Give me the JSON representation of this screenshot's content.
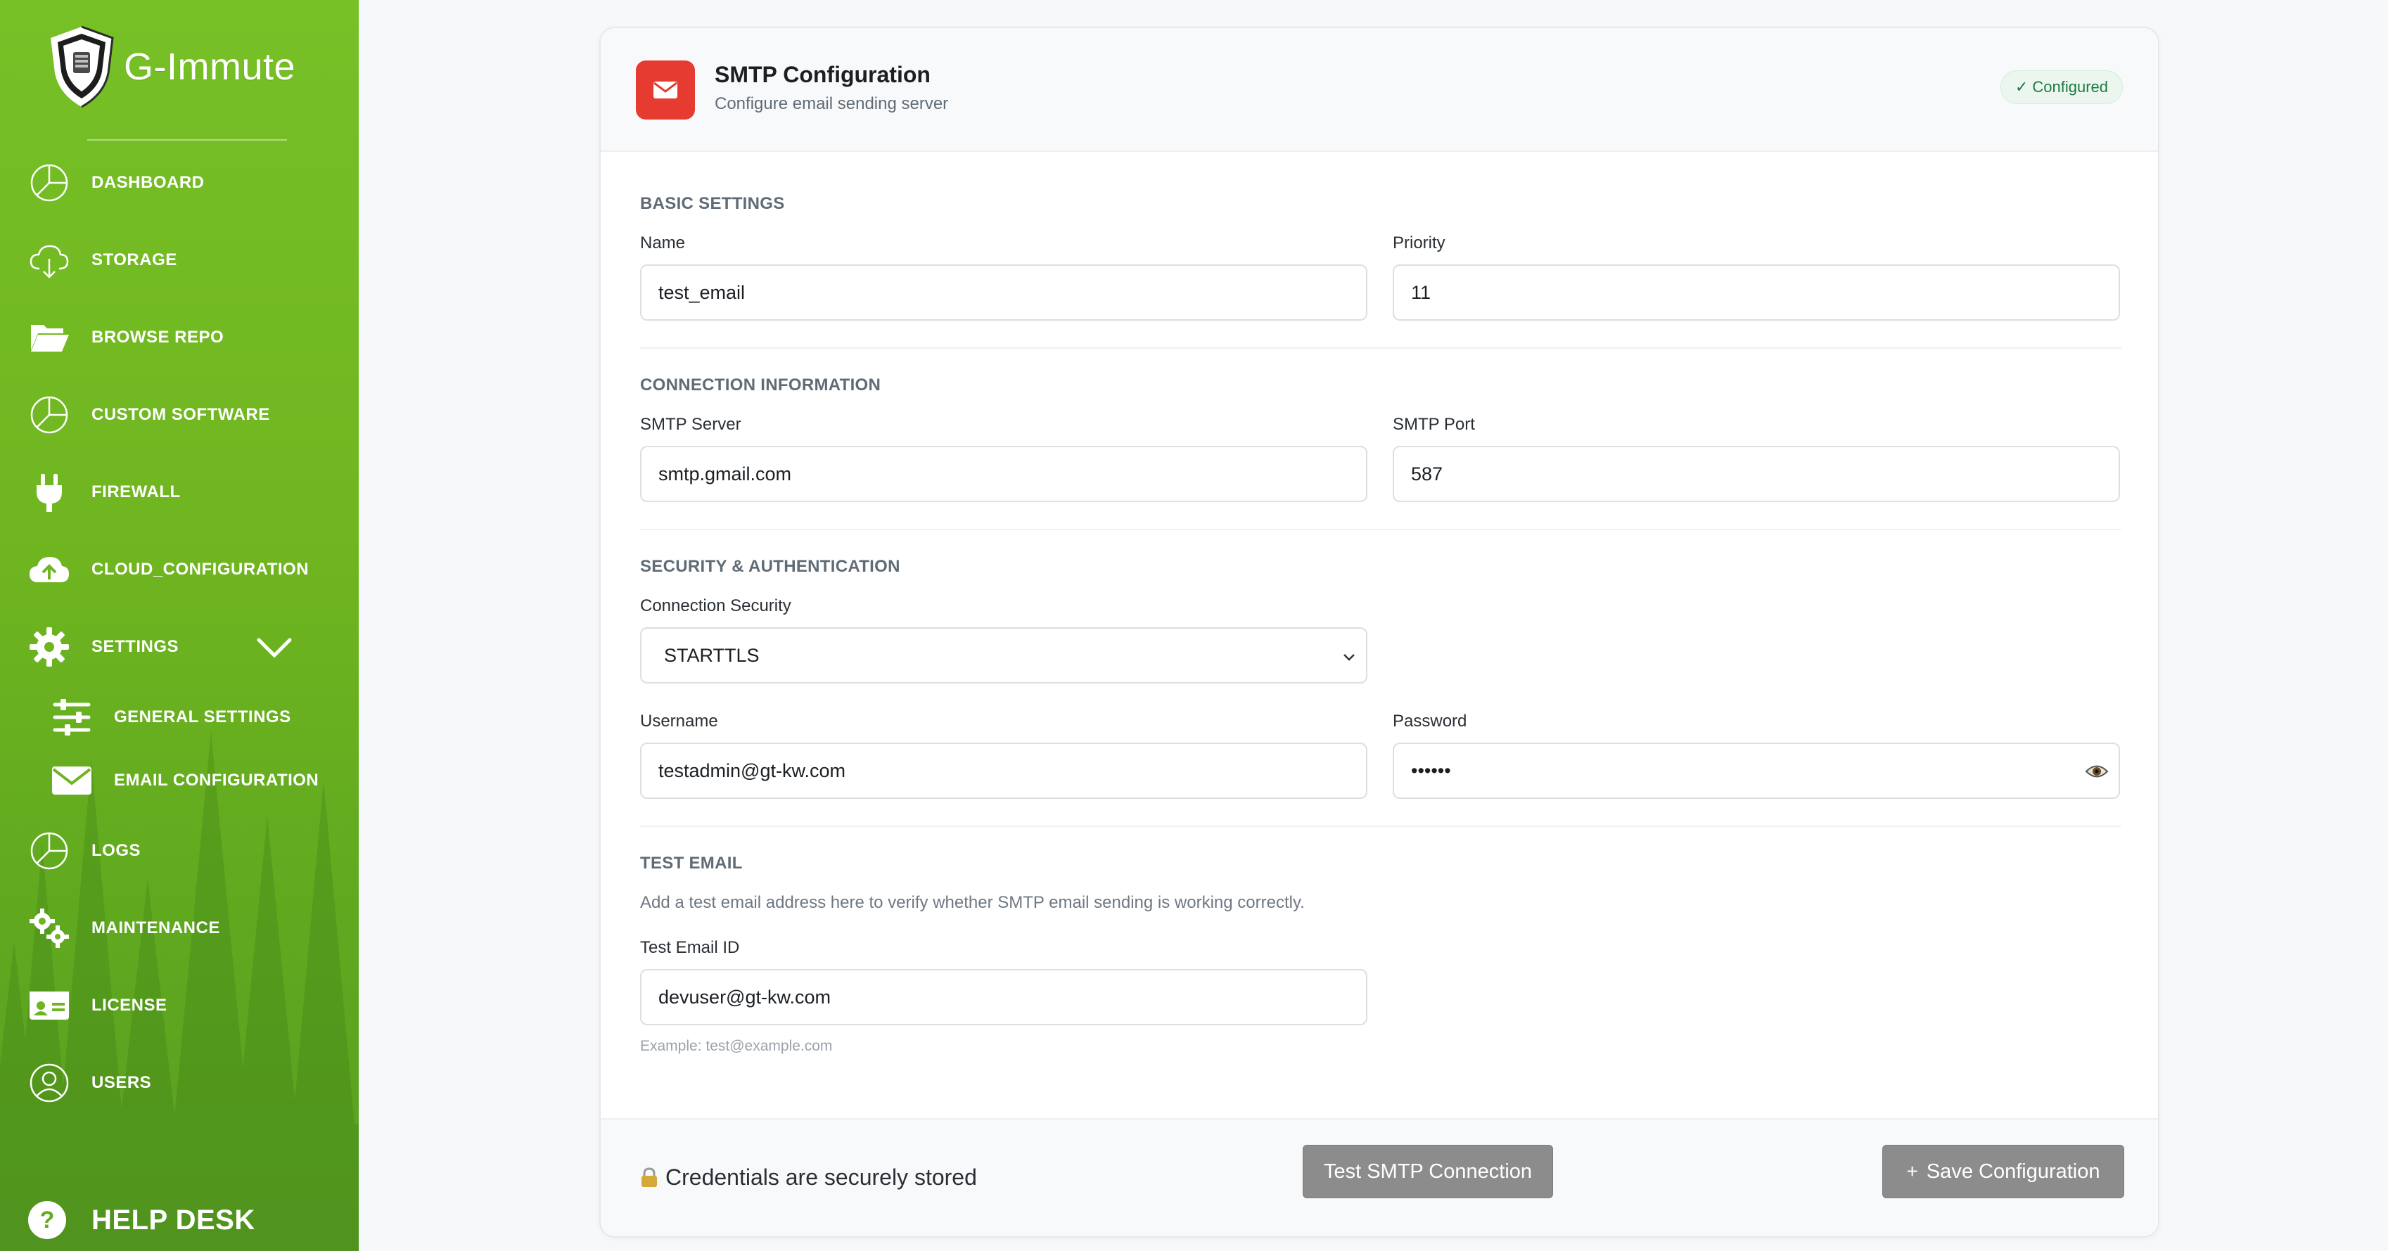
{
  "app": {
    "brand": "G-Immute"
  },
  "sidebar": {
    "items": [
      {
        "label": "DASHBOARD",
        "icon": "pie-chart-icon"
      },
      {
        "label": "STORAGE",
        "icon": "cloud-download-icon"
      },
      {
        "label": "BROWSE REPO",
        "icon": "folder-open-icon"
      },
      {
        "label": "CUSTOM SOFTWARE",
        "icon": "pie-chart-icon"
      },
      {
        "label": "FIREWALL",
        "icon": "plug-icon"
      },
      {
        "label": "CLOUD_CONFIGURATION",
        "icon": "cloud-upload-icon"
      },
      {
        "label": "SETTINGS",
        "icon": "gear-icon"
      },
      {
        "label": "LOGS",
        "icon": "pie-chart-icon"
      },
      {
        "label": "MAINTENANCE",
        "icon": "gears-icon"
      },
      {
        "label": "LICENSE",
        "icon": "id-card-icon"
      },
      {
        "label": "USERS",
        "icon": "user-circle-icon"
      }
    ],
    "sub_items": [
      {
        "label": "GENERAL SETTINGS",
        "icon": "sliders-icon"
      },
      {
        "label": "EMAIL CONFIGURATION",
        "icon": "envelope-icon"
      }
    ],
    "help": {
      "label": "HELP DESK",
      "glyph": "?"
    }
  },
  "card": {
    "title": "SMTP Configuration",
    "subtitle": "Configure email sending server",
    "status": "✓ Configured",
    "sections": {
      "basic": "BASIC SETTINGS",
      "connection": "CONNECTION INFORMATION",
      "security": "SECURITY & AUTHENTICATION",
      "test": "TEST EMAIL"
    },
    "fields": {
      "name": {
        "label": "Name",
        "value": "test_email"
      },
      "priority": {
        "label": "Priority",
        "value": "11"
      },
      "smtp_server": {
        "label": "SMTP Server",
        "value": "smtp.gmail.com"
      },
      "smtp_port": {
        "label": "SMTP Port",
        "value": "587"
      },
      "connection_security": {
        "label": "Connection Security",
        "value": "STARTTLS"
      },
      "username": {
        "label": "Username",
        "value": "testadmin@gt-kw.com"
      },
      "password": {
        "label": "Password",
        "value": "••••••"
      },
      "test_email": {
        "label": "Test Email ID",
        "value": "devuser@gt-kw.com",
        "hint": "Example: test@example.com"
      }
    },
    "test_description": "Add a test email address here to verify whether SMTP email sending is working correctly.",
    "footer": {
      "secure_note": "Credentials are securely stored",
      "test_button": "Test SMTP Connection",
      "save_button": "Save Configuration",
      "save_plus": "+"
    }
  },
  "colors": {
    "sidebar_green": "#77c026",
    "header_icon_red": "#e63b31",
    "button_gray": "#8c8c8c",
    "badge_green": "#1f7a43"
  }
}
